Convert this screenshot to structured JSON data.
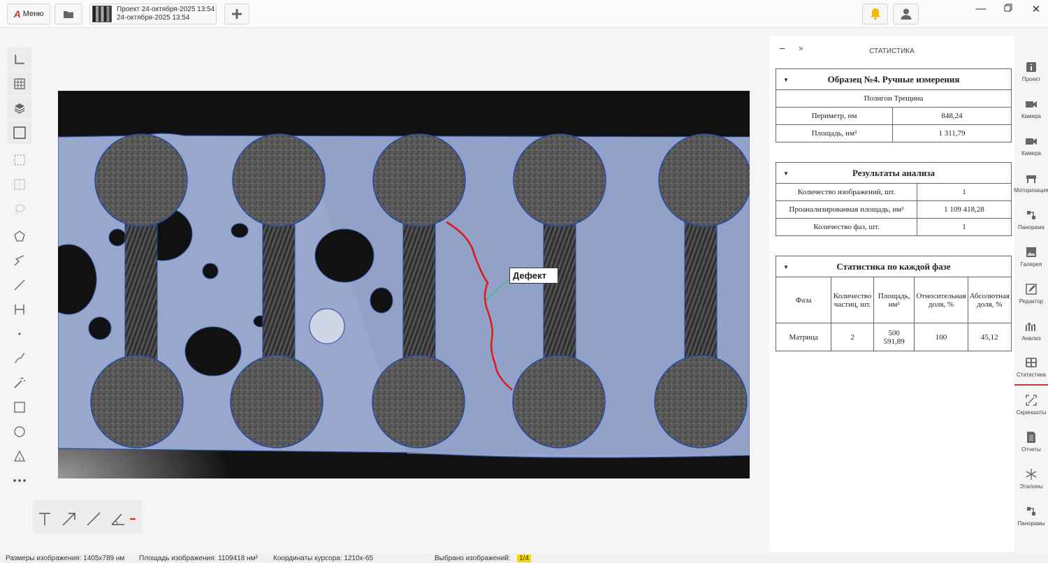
{
  "topbar": {
    "menu_label": "Меню",
    "project_title": "Проект 24-октября-2025 13:54",
    "project_date": "24-октября-2025 13:54"
  },
  "image": {
    "defect_label": "Дефект"
  },
  "stats": {
    "title": "СТАТИСТИКА",
    "sample": {
      "caption": "Образец №4. Ручные измерения",
      "subtitle": "Полигон Трещина",
      "rows": [
        {
          "label": "Периметр, нм",
          "value": "848,24"
        },
        {
          "label": "Площадь, нм²",
          "value": "1 311,79"
        }
      ]
    },
    "analysis": {
      "caption": "Результаты анализа",
      "rows": [
        {
          "label": "Количество изображений, шт.",
          "value": "1"
        },
        {
          "label": "Проанализированная площадь, нм²",
          "value": "1 109 418,28"
        },
        {
          "label": "Количество фаз, шт.",
          "value": "1"
        }
      ]
    },
    "phases": {
      "caption": "Статистика по каждой фазе",
      "headers": [
        "Фаза",
        "Количество частиц, шт.",
        "Площадь, нм²",
        "Относительная доля, %",
        "Абсолютная доля, %"
      ],
      "rows": [
        {
          "phase": "Матрица",
          "count": "2",
          "area": "500 591,89",
          "rel": "100",
          "abs": "45,12"
        }
      ]
    }
  },
  "rightnav": [
    {
      "label": "Проект",
      "icon": "info-icon"
    },
    {
      "label": "Камера",
      "icon": "camera-icon"
    },
    {
      "label": "Камера",
      "icon": "camera-icon"
    },
    {
      "label": "Моторизация",
      "icon": "stage-icon"
    },
    {
      "label": "Панорама",
      "icon": "panorama-icon"
    },
    {
      "label": "Галерея",
      "icon": "gallery-icon"
    },
    {
      "label": "Редактор",
      "icon": "edit-icon"
    },
    {
      "label": "Анализ",
      "icon": "analysis-icon"
    },
    {
      "label": "Статистика",
      "icon": "table-icon"
    },
    {
      "label": "Скриншоты",
      "icon": "screenshot-icon"
    },
    {
      "label": "Отчеты",
      "icon": "report-icon"
    },
    {
      "label": "Эталоны",
      "icon": "asterisk-icon"
    },
    {
      "label": "Панорамы",
      "icon": "panoramas-icon"
    }
  ],
  "status": {
    "image_size": "Размеры изображения: 1405x789 нм",
    "image_area": "Площадь изображения: 1109418 нм²",
    "cursor": "Координаты курсора: 1210x-65",
    "selected_label": "Выбрано изображений:",
    "selected_value": "1/4"
  }
}
